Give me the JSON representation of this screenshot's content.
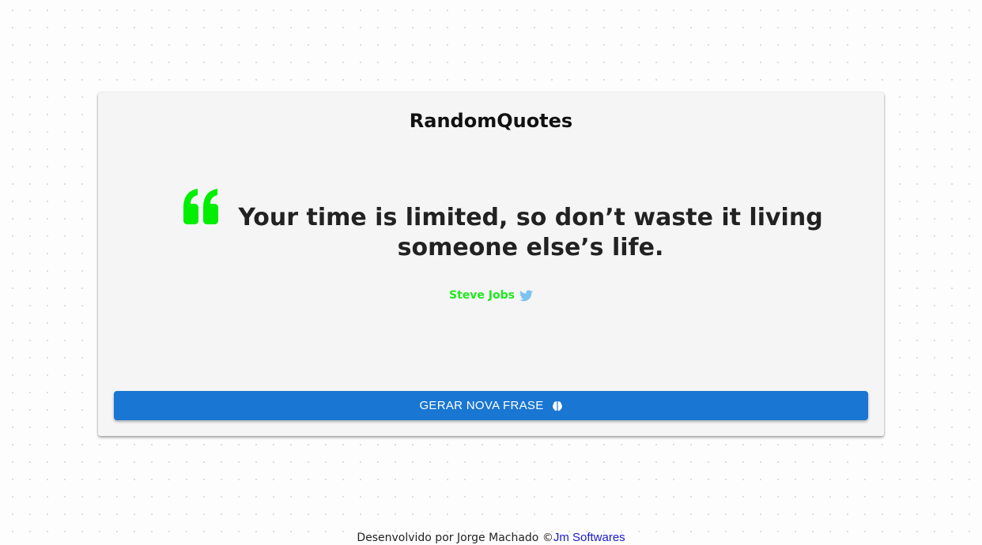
{
  "app": {
    "title": "RandomQuotes"
  },
  "quote": {
    "text": "Your time is limited, so don’t waste it living someone else’s life.",
    "author": "Steve Jobs",
    "quote_icon": "quote-left-icon",
    "share_icon": "twitter-icon"
  },
  "actions": {
    "generate_label": "GERAR NOVA FRASE",
    "generate_icon": "brain-icon"
  },
  "footer": {
    "prefix": "Desenvolvido por Jorge Machado ©",
    "link_text": "Jm Softwares"
  },
  "colors": {
    "accent_green": "#1ee81e",
    "button_blue": "#1976d2",
    "twitter_blue": "#7cc4ee",
    "link_blue": "#1a1acc"
  }
}
